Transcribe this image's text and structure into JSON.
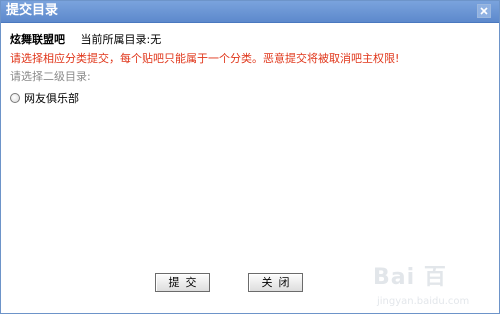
{
  "window": {
    "title": "提交目录",
    "close_icon": "close-icon"
  },
  "forum": {
    "name": "炫舞联盟吧",
    "current_dir": "当前所属目录:无"
  },
  "warning": "请选择相应分类提交，每个贴吧只能属于一个分类。恶意提交将被取消吧主权限!",
  "prompt": "请选择二级目录:",
  "options": [
    {
      "label": "网友俱乐部",
      "selected": false
    }
  ],
  "buttons": {
    "submit": "提交",
    "close": "关闭"
  },
  "watermark": {
    "brand": "Bai 百",
    "url": "jingyan.baidu.com"
  },
  "colors": {
    "titlebar": "#6b93d3",
    "warning": "#e0361a",
    "prompt": "#8a8a8a"
  }
}
